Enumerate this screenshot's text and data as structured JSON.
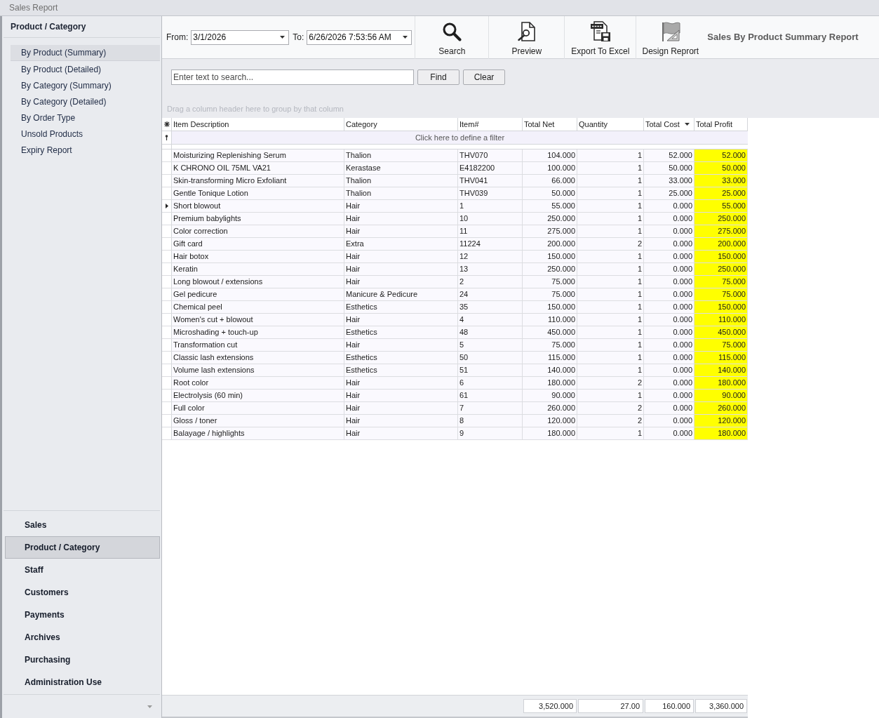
{
  "window": {
    "title": "Sales Report"
  },
  "sidebar": {
    "heading": "Product / Category",
    "items": [
      {
        "label": "By Product (Summary)",
        "selected": true
      },
      {
        "label": "By Product (Detailed)",
        "selected": false
      },
      {
        "label": "By Category (Summary)",
        "selected": false
      },
      {
        "label": "By Category (Detailed)",
        "selected": false
      },
      {
        "label": "By Order Type",
        "selected": false
      },
      {
        "label": "Unsold Products",
        "selected": false
      },
      {
        "label": "Expiry Report",
        "selected": false
      }
    ],
    "groups": [
      {
        "label": "Sales",
        "selected": false
      },
      {
        "label": "Product / Category",
        "selected": true
      },
      {
        "label": "Staff",
        "selected": false
      },
      {
        "label": "Customers",
        "selected": false
      },
      {
        "label": "Payments",
        "selected": false
      },
      {
        "label": "Archives",
        "selected": false
      },
      {
        "label": "Purchasing",
        "selected": false
      },
      {
        "label": "Administration Use",
        "selected": false
      }
    ]
  },
  "toolbar": {
    "from": {
      "label": "From:",
      "value": "3/1/2026"
    },
    "to": {
      "label": "To:",
      "value": "6/26/2026 7:53:56 AM"
    },
    "buttons": [
      {
        "label": "Search",
        "kind": "search"
      },
      {
        "label": "Preview",
        "kind": "preview"
      },
      {
        "label": "Export To Excel",
        "kind": "excel"
      },
      {
        "label": "Design Reprort",
        "kind": "design"
      }
    ],
    "report_title": "Sales By Product Summary Report"
  },
  "search": {
    "placeholder": "Enter text to search...",
    "buttons": [
      "Find",
      "Clear"
    ]
  },
  "group_panel": "Drag a column header here to group by that column",
  "table": {
    "columns": [
      {
        "label": "Item Description",
        "sorted": false,
        "highlighted": false
      },
      {
        "label": "Category",
        "sorted": false,
        "highlighted": false
      },
      {
        "label": "Item#",
        "sorted": false,
        "highlighted": false
      },
      {
        "label": "Total Net",
        "sorted": false,
        "highlighted": false
      },
      {
        "label": "Quantity",
        "sorted": false,
        "highlighted": false
      },
      {
        "label": "Total Cost",
        "sorted": true,
        "highlighted": false
      },
      {
        "label": "Total Profit",
        "sorted": false,
        "highlighted": true
      }
    ],
    "filter_prompt": "Click here to define a filter",
    "rows": [
      {
        "selected": false,
        "cells": [
          "Moisturizing Replenishing Serum",
          "Thalion",
          "THV070",
          "104.000",
          "1",
          "52.000",
          "52.000"
        ]
      },
      {
        "selected": false,
        "cells": [
          "K CHRONO OIL 75ML VA21",
          "Kerastase",
          "E4182200",
          "100.000",
          "1",
          "50.000",
          "50.000"
        ]
      },
      {
        "selected": false,
        "cells": [
          "Skin-transforming Micro Exfoliant",
          "Thalion",
          "THV041",
          "66.000",
          "1",
          "33.000",
          "33.000"
        ]
      },
      {
        "selected": false,
        "cells": [
          "Gentle Tonique Lotion",
          "Thalion",
          "THV039",
          "50.000",
          "1",
          "25.000",
          "25.000"
        ]
      },
      {
        "selected": true,
        "cells": [
          "Short blowout",
          "Hair",
          "1",
          "55.000",
          "1",
          "0.000",
          "55.000"
        ]
      },
      {
        "selected": false,
        "cells": [
          "Premium babylights",
          "Hair",
          "10",
          "250.000",
          "1",
          "0.000",
          "250.000"
        ]
      },
      {
        "selected": false,
        "cells": [
          "Color correction",
          "Hair",
          "11",
          "275.000",
          "1",
          "0.000",
          "275.000"
        ]
      },
      {
        "selected": false,
        "cells": [
          "Gift card",
          "Extra",
          "11224",
          "200.000",
          "2",
          "0.000",
          "200.000"
        ]
      },
      {
        "selected": false,
        "cells": [
          "Hair botox",
          "Hair",
          "12",
          "150.000",
          "1",
          "0.000",
          "150.000"
        ]
      },
      {
        "selected": false,
        "cells": [
          "Keratin",
          "Hair",
          "13",
          "250.000",
          "1",
          "0.000",
          "250.000"
        ]
      },
      {
        "selected": false,
        "cells": [
          "Long blowout / extensions",
          "Hair",
          "2",
          "75.000",
          "1",
          "0.000",
          "75.000"
        ]
      },
      {
        "selected": false,
        "cells": [
          "Gel pedicure",
          "Manicure & Pedicure",
          "24",
          "75.000",
          "1",
          "0.000",
          "75.000"
        ]
      },
      {
        "selected": false,
        "cells": [
          "Chemical peel",
          "Esthetics",
          "35",
          "150.000",
          "1",
          "0.000",
          "150.000"
        ]
      },
      {
        "selected": false,
        "cells": [
          "Women's cut + blowout",
          "Hair",
          "4",
          "110.000",
          "1",
          "0.000",
          "110.000"
        ]
      },
      {
        "selected": false,
        "cells": [
          "Microshading + touch-up",
          "Esthetics",
          "48",
          "450.000",
          "1",
          "0.000",
          "450.000"
        ]
      },
      {
        "selected": false,
        "cells": [
          "Transformation cut",
          "Hair",
          "5",
          "75.000",
          "1",
          "0.000",
          "75.000"
        ]
      },
      {
        "selected": false,
        "cells": [
          "Classic lash extensions",
          "Esthetics",
          "50",
          "115.000",
          "1",
          "0.000",
          "115.000"
        ]
      },
      {
        "selected": false,
        "cells": [
          "Volume lash extensions",
          "Esthetics",
          "51",
          "140.000",
          "1",
          "0.000",
          "140.000"
        ]
      },
      {
        "selected": false,
        "cells": [
          "Root color",
          "Hair",
          "6",
          "180.000",
          "2",
          "0.000",
          "180.000"
        ]
      },
      {
        "selected": false,
        "cells": [
          "Electrolysis (60 min)",
          "Hair",
          "61",
          "90.000",
          "1",
          "0.000",
          "90.000"
        ]
      },
      {
        "selected": false,
        "cells": [
          "Full color",
          "Hair",
          "7",
          "260.000",
          "2",
          "0.000",
          "260.000"
        ]
      },
      {
        "selected": false,
        "cells": [
          "Gloss / toner",
          "Hair",
          "8",
          "120.000",
          "2",
          "0.000",
          "120.000"
        ]
      },
      {
        "selected": false,
        "cells": [
          "Balayage / highlights",
          "Hair",
          "9",
          "180.000",
          "1",
          "0.000",
          "180.000"
        ]
      }
    ],
    "summary": [
      "3,520.000",
      "27.00",
      "160.000",
      "3,360.000"
    ]
  }
}
